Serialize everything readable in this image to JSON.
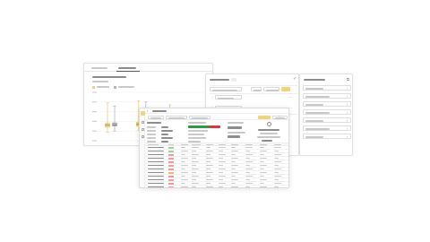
{
  "colors": {
    "accent_yellow": "#f3d27a",
    "accent_yellow_soft": "#fbe9b3",
    "gray_box": "#b5b5b5",
    "success_green": "#9ad39a",
    "error_red": "#ef9a9a",
    "amber": "#f6b26b",
    "progress_green": "#2e9a46",
    "progress_red": "#d43c3c"
  },
  "icons": {
    "back": "back-arrow-icon",
    "expand": "expand-icon",
    "close": "close-icon",
    "checkbox": "checkbox-icon",
    "drag": "drag-handle-icon",
    "chart": "chart-icon",
    "filter": "filter-icon"
  },
  "chart_window": {
    "tabs": [
      "",
      ""
    ],
    "title": "",
    "chart_data": {
      "type": "box",
      "categories": [
        "",
        "",
        "",
        "",
        "",
        ""
      ],
      "series": [
        {
          "values": [
            {
              "min": 0.18,
              "q1": 0.28,
              "median": 0.32,
              "q3": 0.36,
              "max": 0.78
            },
            {
              "min": 0.22,
              "q1": 0.3,
              "median": 0.34,
              "q3": 0.38,
              "max": 0.82
            },
            {
              "min": 0.26,
              "q1": 0.34,
              "median": 0.4,
              "q3": 0.44,
              "max": 0.74
            }
          ]
        },
        {
          "values": [
            {
              "min": 0.2,
              "q1": 0.3,
              "median": 0.33,
              "q3": 0.37,
              "max": 0.72
            },
            {
              "min": 0.24,
              "q1": 0.32,
              "median": 0.36,
              "q3": 0.4,
              "max": 0.8
            },
            {
              "min": 0.3,
              "q1": 0.36,
              "median": 0.4,
              "q3": 0.44,
              "max": 0.66
            }
          ]
        }
      ],
      "grid": true,
      "legend": "top-left"
    }
  },
  "rules_panel": {
    "title": "",
    "add_button_label": "",
    "highlight_button_label": "",
    "rules": [
      {
        "label": "",
        "has_dropdown": true
      },
      {
        "label": "",
        "has_dropdown": true
      }
    ]
  },
  "library_panel": {
    "title": "",
    "items": [
      "",
      "",
      "",
      "",
      "",
      "",
      ""
    ]
  },
  "results_panel": {
    "title": "",
    "toolbar": [
      "",
      "",
      ""
    ],
    "overview_title": "",
    "overview_rows": [
      [
        "",
        ""
      ],
      [
        "",
        ""
      ],
      [
        "",
        ""
      ],
      [
        "",
        ""
      ],
      [
        "",
        ""
      ]
    ],
    "progress": {
      "label": "",
      "green_fraction": 0.68,
      "red_fraction": 0.32
    },
    "stat_value_1": "",
    "stat_value_2": "",
    "rows": [
      {
        "status": "success"
      },
      {
        "status": "success"
      },
      {
        "status": "error"
      },
      {
        "status": "error"
      },
      {
        "status": "error"
      },
      {
        "status": "error"
      },
      {
        "status": "error"
      },
      {
        "status": "amber"
      },
      {
        "status": "error"
      },
      {
        "status": "error"
      },
      {
        "status": "error"
      },
      {
        "status": "error"
      }
    ]
  }
}
